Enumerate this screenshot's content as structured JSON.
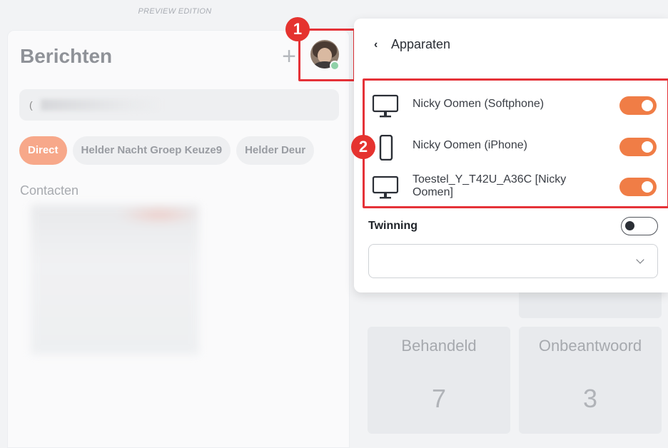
{
  "preview_label": "PREVIEW EDITION",
  "left": {
    "title": "Berichten",
    "search_value": "(",
    "chips": [
      "Direct",
      "Helder Nacht Groep Keuze9",
      "Helder Deur"
    ],
    "contacts_label": "Contacten"
  },
  "annotations": {
    "badge1": "1",
    "badge2": "2",
    "highlight_color": "#e53238"
  },
  "popover": {
    "back_label": "Apparaten",
    "devices": [
      {
        "name": "Nicky Oomen (Softphone)",
        "icon": "monitor-icon",
        "enabled": true
      },
      {
        "name": "Nicky Oomen (iPhone)",
        "icon": "smartphone-icon",
        "enabled": true
      },
      {
        "name": "Toestel_Y_T42U_A36C [Nicky Oomen]",
        "icon": "monitor-icon",
        "enabled": true
      }
    ],
    "twinning_label": "Twinning",
    "twinning_enabled": false,
    "select_value": ""
  },
  "stats": [
    {
      "label": "Behandeld",
      "value": "7"
    },
    {
      "label": "Onbeantwoord",
      "value": "3"
    }
  ],
  "colors": {
    "accent_orange": "#f07d46",
    "chip_active": "#f7a88a"
  }
}
